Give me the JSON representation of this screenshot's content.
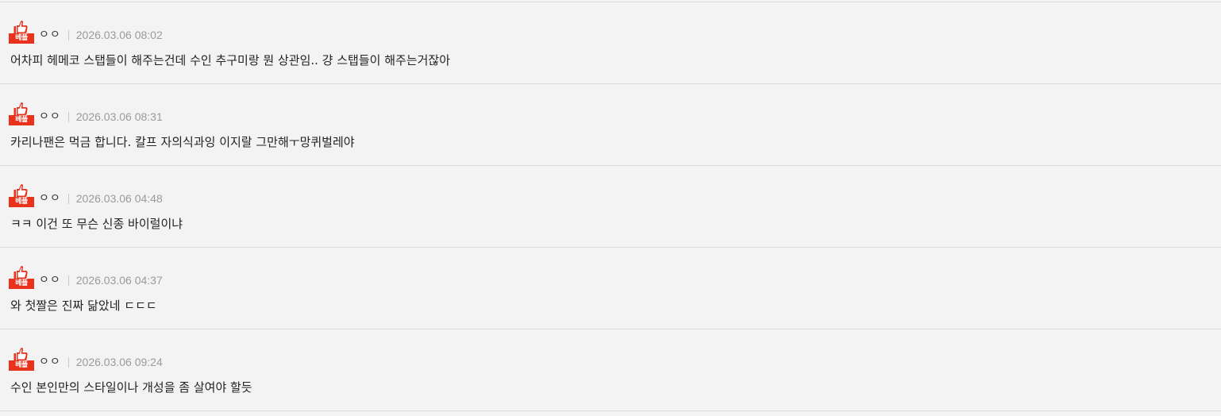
{
  "comments": [
    {
      "badge": "베플",
      "nickname": "ㅇㅇ",
      "date": "2026.03.06 08:02",
      "text": "어차피 헤메코 스탭들이 해주는건데 수인 추구미랑 뭔 상관임.. 걍 스탭들이 해주는거잖아"
    },
    {
      "badge": "베플",
      "nickname": "ㅇㅇ",
      "date": "2026.03.06 08:31",
      "text": "카리나팬은 먹금 합니다. 칼프 자의식과잉 이지랄 그만해ㅜ망퀴벌레야"
    },
    {
      "badge": "베플",
      "nickname": "ㅇㅇ",
      "date": "2026.03.06 04:48",
      "text": "ㅋㅋ 이건 또 무슨 신종 바이럴이냐"
    },
    {
      "badge": "베플",
      "nickname": "ㅇㅇ",
      "date": "2026.03.06 04:37",
      "text": "와 첫짤은 진짜 닮았네 ㄷㄷㄷ"
    },
    {
      "badge": "베플",
      "nickname": "ㅇㅇ",
      "date": "2026.03.06 09:24",
      "text": "수인 본인만의 스타일이나 개성을 좀 살여야 할듯"
    }
  ],
  "colors": {
    "badge_red": "#e8321c",
    "background": "#f3f3f3",
    "divider": "#dcdcdc"
  },
  "icons": {
    "badge": "thumbs-up-icon"
  }
}
